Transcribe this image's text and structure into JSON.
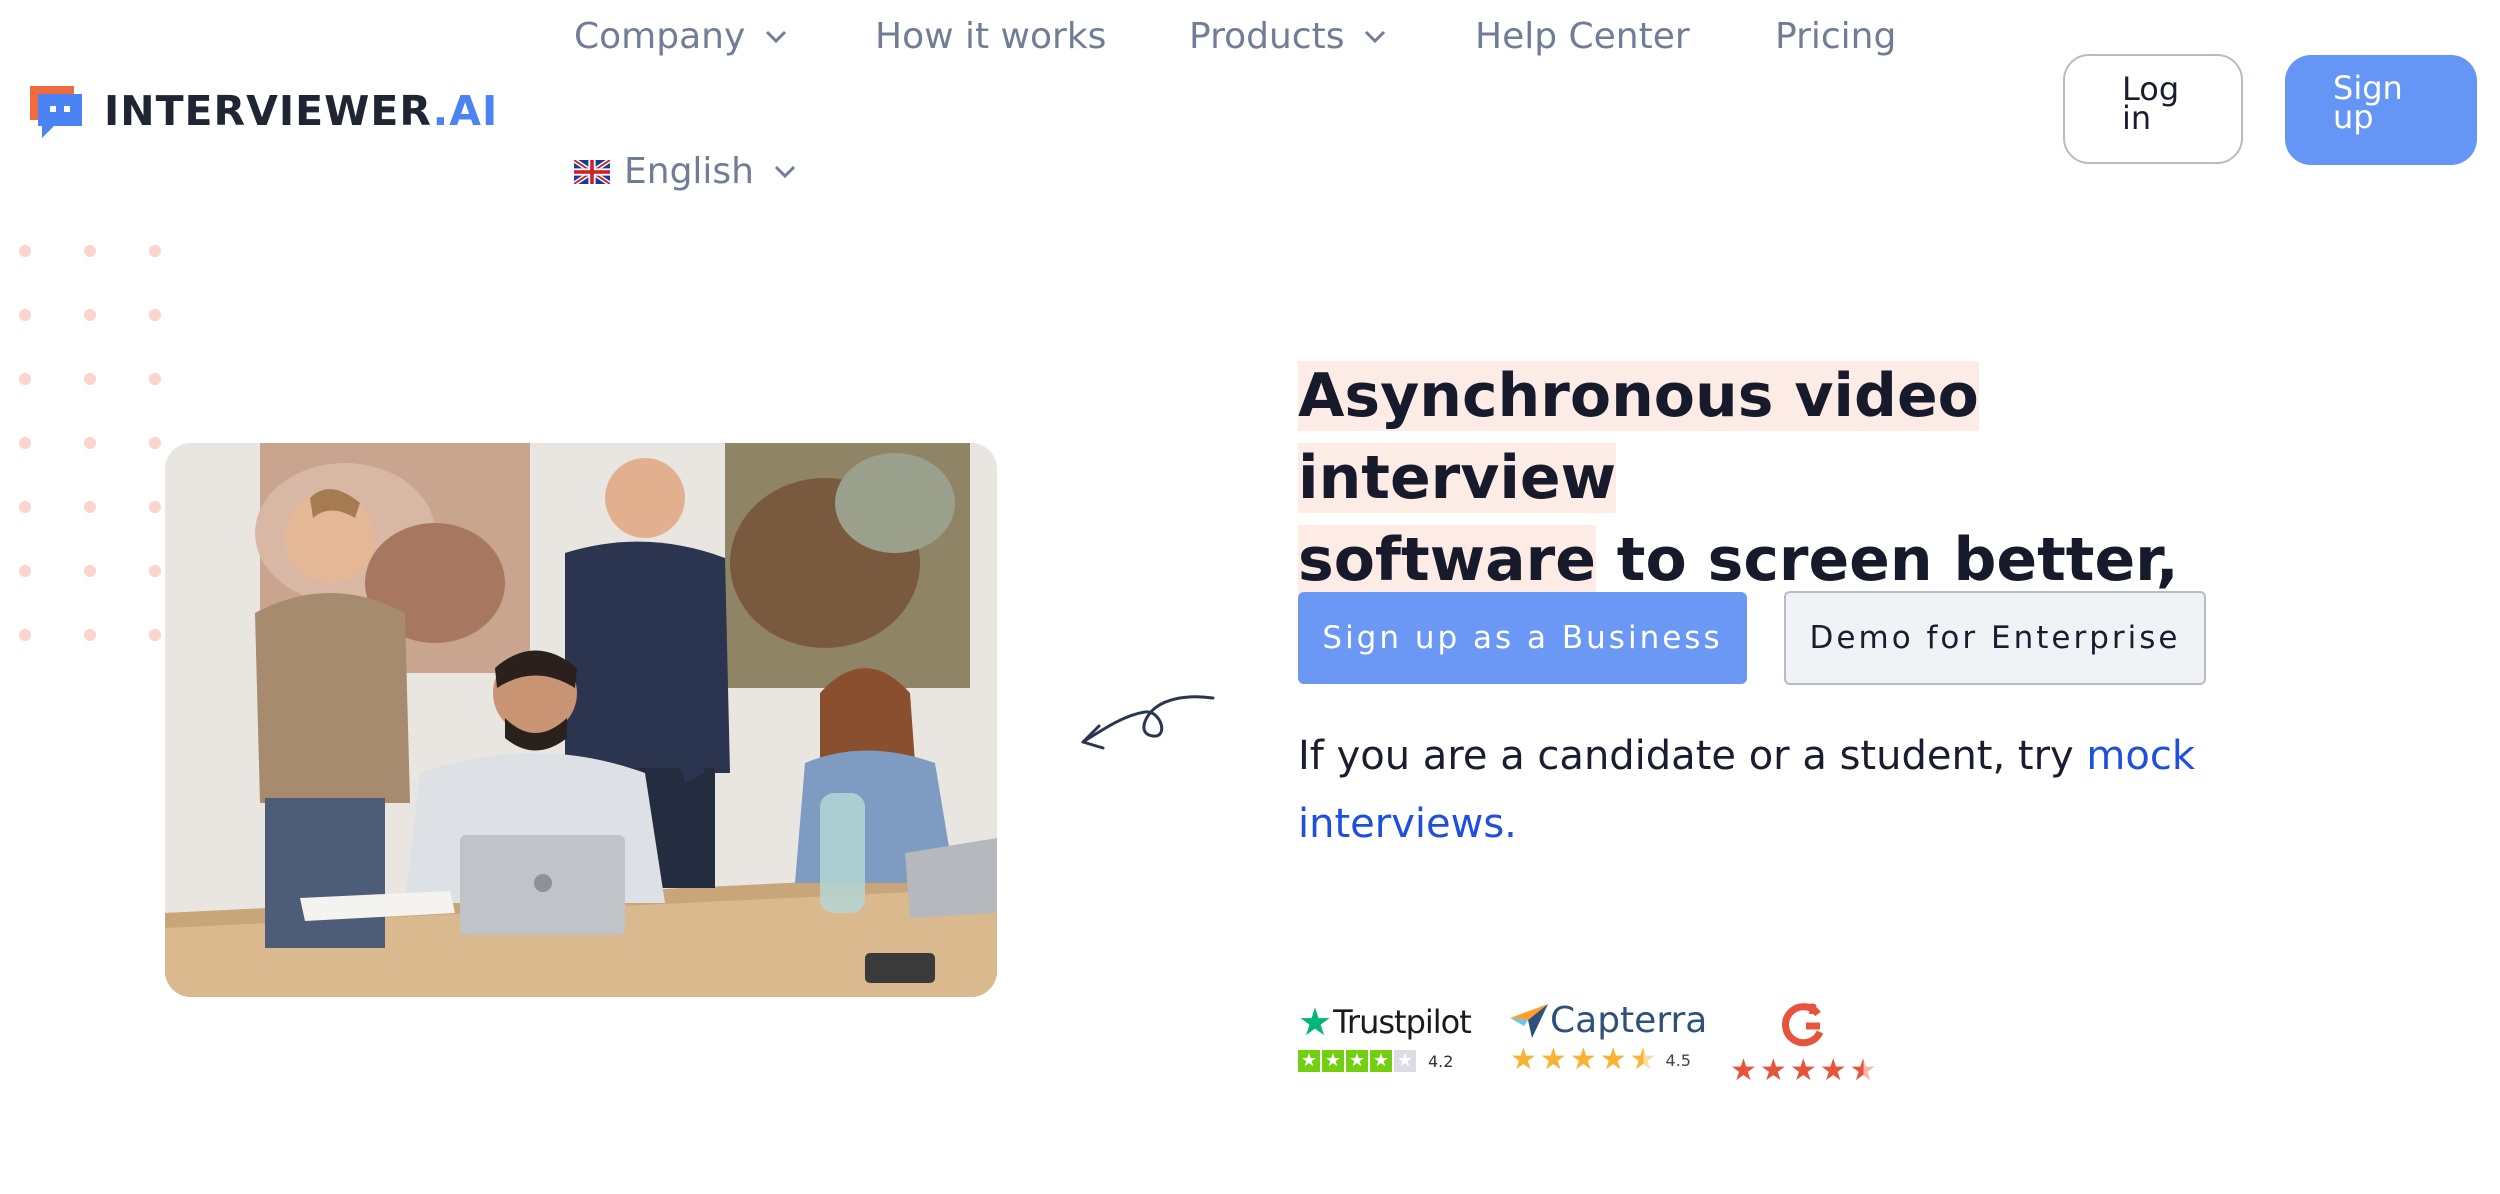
{
  "header": {
    "brand": {
      "name": "INTERVIEWER",
      "suffix": ".AI"
    },
    "nav": {
      "company": "Company",
      "how_it_works": "How it works",
      "products": "Products",
      "help_center": "Help Center",
      "pricing": "Pricing",
      "language": "English"
    },
    "login_line1": "Log",
    "login_line2": "in",
    "signup_line1": "Sign",
    "signup_line2": "up"
  },
  "hero": {
    "headline_hl1": "Asynchronous video interview",
    "headline_hl2": "software",
    "headline_rest": " to screen better, faster.",
    "primary_button": "Sign up as a Business",
    "secondary_button": "Demo for Enterprise",
    "candidate_text": "If you are a candidate or a student, try ",
    "candidate_link": "mock interviews."
  },
  "ratings": {
    "trustpilot": {
      "name": "Trustpilot",
      "score": "4.2"
    },
    "capterra": {
      "name": "Capterra",
      "score": "4.5"
    },
    "g2": {
      "name": "G2"
    }
  },
  "colors": {
    "accent": "#6a98f4",
    "highlight": "#fdece6",
    "link": "#1d4fe0",
    "logo_orange": "#f26b3a",
    "logo_blue": "#4b82f4"
  }
}
